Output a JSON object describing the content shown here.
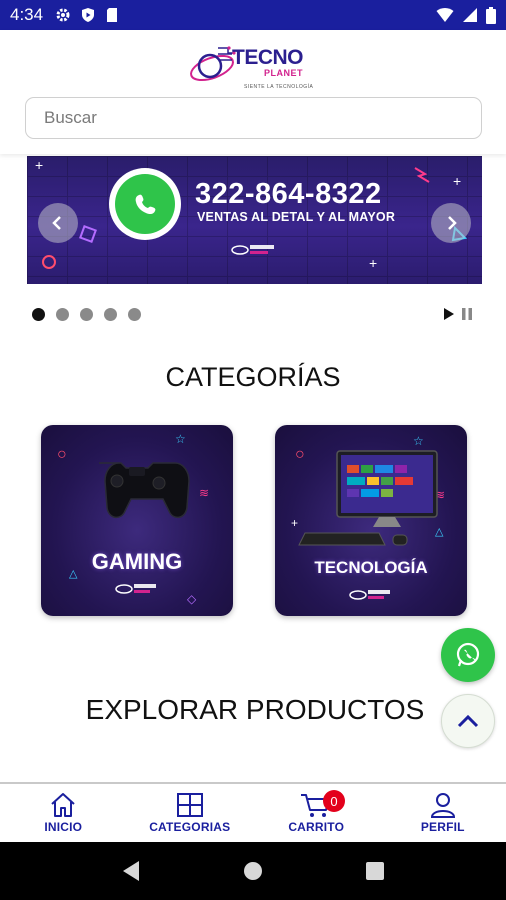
{
  "status_bar": {
    "time": "4:34",
    "background": "#1a1f9e"
  },
  "header": {
    "logo": {
      "name_line1": "TECNO",
      "name_line2": "PLANET",
      "tagline": "SIENTE LA TECNOLOGÍA"
    },
    "search": {
      "placeholder": "Buscar",
      "value": ""
    }
  },
  "banner": {
    "phone": "322-864-8322",
    "subtitle": "VENTAS AL DETAL Y AL MAYOR",
    "slide_count": 5,
    "active_slide": 1
  },
  "categories": {
    "title": "CATEGORÍAS",
    "items": [
      {
        "label": "GAMING",
        "icon": "gamepad-icon"
      },
      {
        "label": "TECNOLOGÍA",
        "icon": "computer-icon"
      }
    ]
  },
  "explore": {
    "title": "EXPLORAR PRODUCTOS"
  },
  "bottom_nav": {
    "items": [
      {
        "label": "INICIO",
        "icon": "home-icon"
      },
      {
        "label": "CATEGORIAS",
        "icon": "grid-icon"
      },
      {
        "label": "CARRITO",
        "icon": "cart-icon",
        "badge": "0"
      },
      {
        "label": "PERFIL",
        "icon": "user-icon"
      }
    ],
    "accent": "#1a1f9e",
    "badge_color": "#e3001b"
  },
  "colors": {
    "whatsapp_green": "#2fc44a",
    "brand_blue": "#1a1f9e",
    "banner_purple": "#3a258c"
  }
}
